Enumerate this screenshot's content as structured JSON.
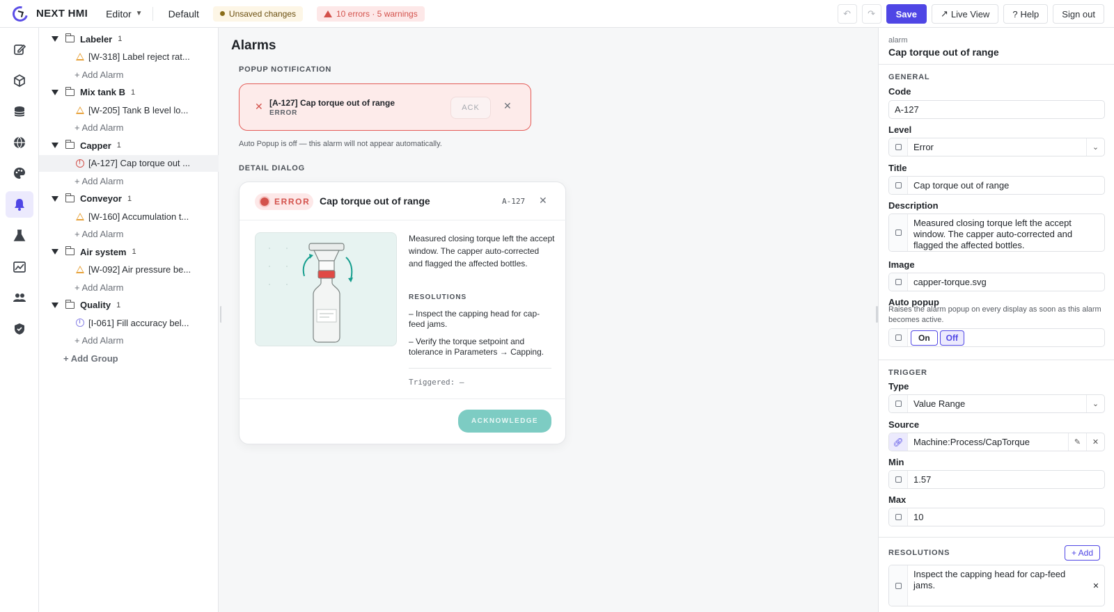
{
  "app": {
    "name": "NEXT HMI",
    "mode": "Editor",
    "project": "Default",
    "unsaved": "Unsaved changes",
    "errors": "10 errors · 5 warnings",
    "save": "Save",
    "live_view": "Live View",
    "help": "Help",
    "sign_out": "Sign out"
  },
  "tree": {
    "groups": [
      {
        "name": "Labeler",
        "count": "1",
        "alarm": "[W-318] Label reject rat...",
        "level": "warning",
        "add": "+ Add Alarm"
      },
      {
        "name": "Mix tank B",
        "count": "1",
        "alarm": "[W-205] Tank B level lo...",
        "level": "warning",
        "add": "+ Add Alarm"
      },
      {
        "name": "Capper",
        "count": "1",
        "alarm": "[A-127] Cap torque out ...",
        "level": "error",
        "add": "+ Add Alarm"
      },
      {
        "name": "Conveyor",
        "count": "1",
        "alarm": "[W-160] Accumulation t...",
        "level": "warning",
        "add": "+ Add Alarm"
      },
      {
        "name": "Air system",
        "count": "1",
        "alarm": "[W-092] Air pressure be...",
        "level": "warning",
        "add": "+ Add Alarm"
      },
      {
        "name": "Quality",
        "count": "1",
        "alarm": "[I-061] Fill accuracy bel...",
        "level": "info",
        "add": "+ Add Alarm"
      }
    ],
    "add_group": "+ Add Group"
  },
  "main": {
    "title": "Alarms",
    "popup_label": "POPUP NOTIFICATION",
    "popup": {
      "title": "[A-127] Cap torque out of range",
      "level": "ERROR",
      "ack": "ACK"
    },
    "note": "Auto Popup is off — this alarm will not appear automatically.",
    "dialog_label": "DETAIL DIALOG",
    "dialog": {
      "badge": "ERROR",
      "title": "Cap torque out of range",
      "code": "A-127",
      "description": "Measured closing torque left the accept window. The capper auto-corrected and flagged the affected bottles.",
      "resolutions_label": "RESOLUTIONS",
      "resolutions": [
        "– Inspect the capping head for cap-feed jams.",
        "– Verify the torque setpoint and tolerance in Parameters → Capping."
      ],
      "triggered": "Triggered: —",
      "acknowledge": "ACKNOWLEDGE"
    }
  },
  "inspector": {
    "kind": "alarm",
    "name": "Cap torque out of range",
    "general": "GENERAL",
    "code_label": "Code",
    "code": "A-127",
    "level_label": "Level",
    "level": "Error",
    "title_label": "Title",
    "title": "Cap torque out of range",
    "desc_label": "Description",
    "description": "Measured closing torque left the accept window. The capper auto-corrected and flagged the affected bottles.",
    "image_label": "Image",
    "image": "capper-torque.svg",
    "autopopup_label": "Auto popup",
    "autopopup_help": "Raises the alarm popup on every display as soon as this alarm becomes active.",
    "on": "On",
    "off": "Off",
    "trigger": "TRIGGER",
    "type_label": "Type",
    "type": "Value Range",
    "source_label": "Source",
    "source": "Machine:Process/CapTorque",
    "min_label": "Min",
    "min": "1.57",
    "max_label": "Max",
    "max": "10",
    "resolutions": "RESOLUTIONS",
    "add": "+ Add",
    "resolution_1": "Inspect the capping head for cap-feed jams."
  },
  "colors": {
    "accent": "#4f46e5",
    "error": "#d3524c",
    "warning": "#e7a23a",
    "teal": "#7dccc3"
  }
}
